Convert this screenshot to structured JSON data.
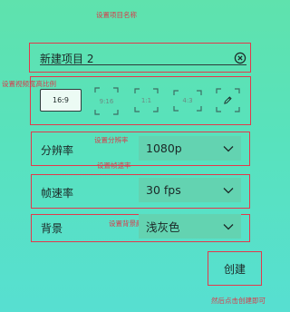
{
  "annotations": {
    "name": "设置项目名称",
    "ratio": "设置视频宽高比例",
    "resolution": "设置分辨率",
    "fps": "设置帧速率",
    "background": "设置背景颜色",
    "final": "然后点击创建即可"
  },
  "project": {
    "name_value": "新建项目 2",
    "clear_icon": "close-circle-icon"
  },
  "aspect_ratios": {
    "options": [
      "16:9",
      "9:16",
      "1:1",
      "4:3"
    ],
    "selected": "16:9",
    "custom_icon": "pencil-icon"
  },
  "settings": {
    "resolution": {
      "label": "分辨率",
      "value": "1080p"
    },
    "fps": {
      "label": "帧速率",
      "value": "30 fps"
    },
    "background": {
      "label": "背景",
      "value": "浅灰色"
    }
  },
  "create_label": "创建",
  "colors": {
    "accent_red": "#e2394c",
    "dropdown_bg": "#63d3b1",
    "selected_bg": "#ecfbf4"
  }
}
